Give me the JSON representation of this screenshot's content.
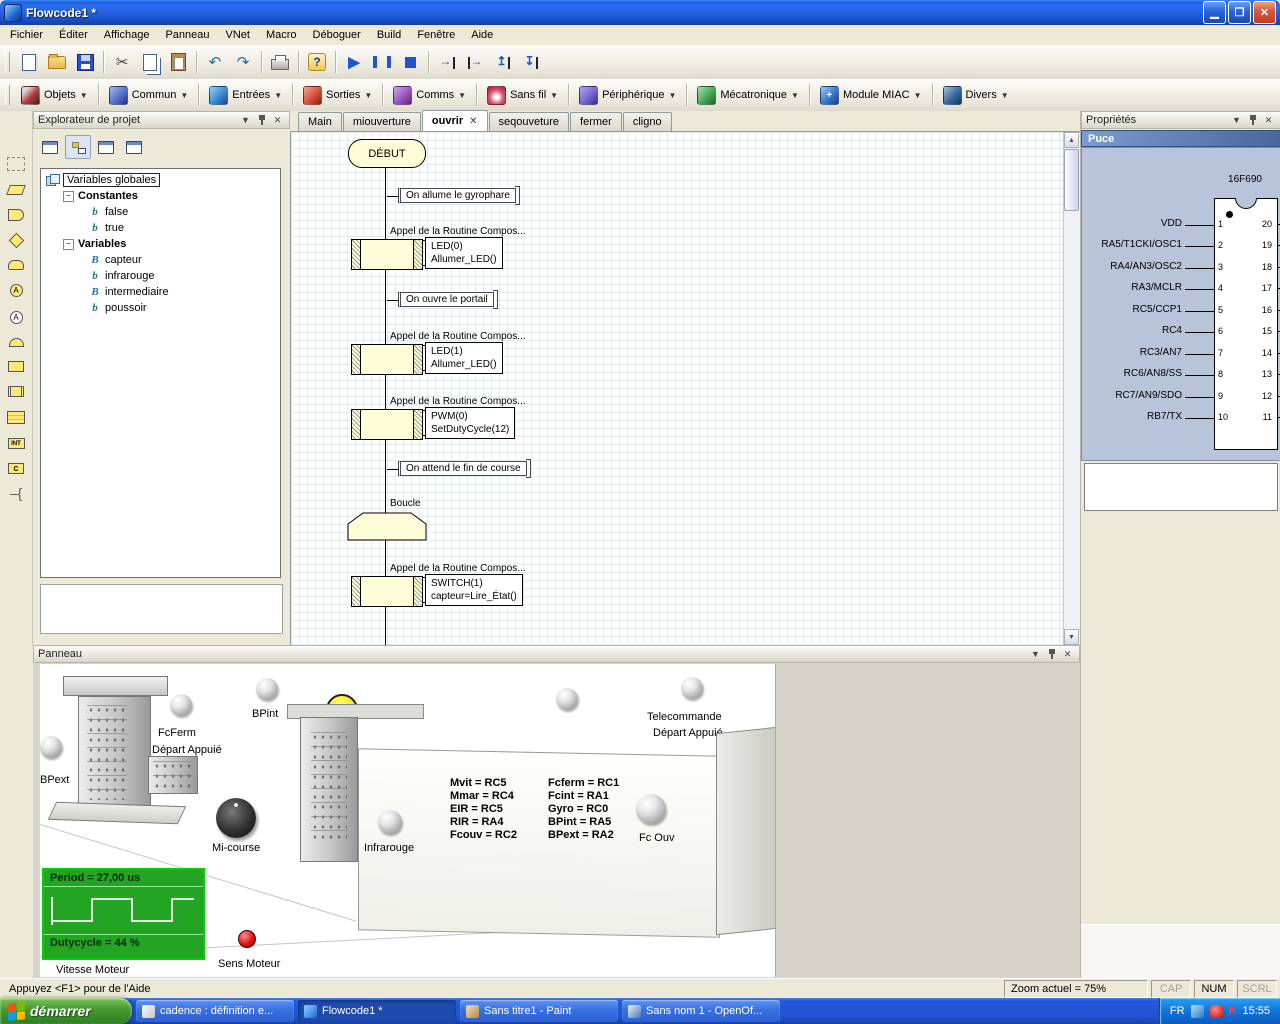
{
  "colors": {
    "titlebar_blue": "#1E5EE8",
    "taskbar_blue": "#2458DC",
    "start_green": "#469A31",
    "flow_yellow": "#FFFCD8",
    "scope_green": "#23A423",
    "puce_banner_blue": "#46689C"
  },
  "window": {
    "title": "Flowcode1 *"
  },
  "menubar": {
    "items": [
      "Fichier",
      "Éditer",
      "Affichage",
      "Panneau",
      "VNet",
      "Macro",
      "Déboguer",
      "Build",
      "Fenêtre",
      "Aide"
    ]
  },
  "toolbar": {
    "buttons": [
      "new-icon",
      "open-icon",
      "save-icon",
      "cut-icon",
      "copy-icon",
      "paste-icon",
      "undo-icon",
      "redo-icon",
      "print-icon",
      "help-icon",
      "run-icon",
      "pause-icon",
      "stop-icon",
      "step-into-icon",
      "step-over-icon",
      "step-out-icon",
      "run-to-cursor-icon"
    ]
  },
  "components": {
    "items": [
      {
        "label": "Objets",
        "icon": "objects-icon"
      },
      {
        "label": "Commun",
        "icon": "common-icon"
      },
      {
        "label": "Entrées",
        "icon": "inputs-icon"
      },
      {
        "label": "Sorties",
        "icon": "outputs-icon"
      },
      {
        "label": "Comms",
        "icon": "comms-icon"
      },
      {
        "label": "Sans fil",
        "icon": "wireless-icon"
      },
      {
        "label": "Périphérique",
        "icon": "peripheral-icon"
      },
      {
        "label": "Mécatronique",
        "icon": "mechatronics-icon"
      },
      {
        "label": "Module MIAC",
        "icon": "miac-module-icon"
      },
      {
        "label": "Divers",
        "icon": "misc-icon"
      }
    ]
  },
  "left_toolbar": {
    "icons": [
      "selection-icon",
      "io-icon",
      "delay-icon",
      "decision-icon",
      "switch-icon",
      "connection-point-icon",
      "jump-icon",
      "event-icon",
      "calculation-icon",
      "component-macro-icon",
      "macro-icon",
      "interrupt-icon",
      "c-code-icon",
      "comment-icon"
    ]
  },
  "explorer": {
    "title": "Explorateur de projet",
    "root": "Variables globales",
    "groups": [
      {
        "label": "Constantes",
        "items": [
          "false",
          "true"
        ]
      },
      {
        "label": "Variables",
        "items": [
          "capteur",
          "infrarouge",
          "intermediaire",
          "poussoir"
        ]
      }
    ]
  },
  "tabs": {
    "active": "ouvrir",
    "items": [
      {
        "label": "Main"
      },
      {
        "label": "miouverture"
      },
      {
        "label": "ouvrir"
      },
      {
        "label": "seqouveture"
      },
      {
        "label": "fermer"
      },
      {
        "label": "cligno"
      }
    ]
  },
  "flowchart": {
    "start_label": "DÉBUT",
    "routine_caption": "Appel de la Routine Compos...",
    "loop_caption": "Boucle",
    "comments": [
      "On allume le gyrophare",
      "On ouvre le portail",
      "On attend le fin de course"
    ],
    "calls": [
      {
        "line1": "LED(0)",
        "line2": "Allumer_LED()"
      },
      {
        "line1": "LED(1)",
        "line2": "Allumer_LED()"
      },
      {
        "line1": "PWM(0)",
        "line2": "SetDutyCycle(12)"
      },
      {
        "line1": "SWITCH(1)",
        "line2": "capteur=Lire_État()"
      }
    ]
  },
  "properties": {
    "title": "Propriétés",
    "section": "Puce",
    "chip_name": "16F690",
    "left_pins": [
      {
        "label": "VDD",
        "num": "1"
      },
      {
        "label": "RA5/T1CKI/OSC1",
        "num": "2"
      },
      {
        "label": "RA4/AN3/OSC2",
        "num": "3"
      },
      {
        "label": "RA3/MCLR",
        "num": "4"
      },
      {
        "label": "RC5/CCP1",
        "num": "5"
      },
      {
        "label": "RC4",
        "num": "6"
      },
      {
        "label": "RC3/AN7",
        "num": "7"
      },
      {
        "label": "RC6/AN8/SS",
        "num": "8"
      },
      {
        "label": "RC7/AN9/SDO",
        "num": "9"
      },
      {
        "label": "RB7/TX",
        "num": "10"
      }
    ],
    "right_pins": [
      "20",
      "19",
      "18",
      "17",
      "16",
      "15",
      "14",
      "13",
      "12",
      "11"
    ]
  },
  "panel": {
    "title": "Panneau",
    "labels": {
      "bpext": "BPext",
      "fcferm": "FcFerm",
      "fcferm2": "Départ Appuié",
      "bpint": "BPint",
      "telecommande": "Telecommande",
      "telecommande2": "Départ Appuié",
      "micourse": "Mi-course",
      "infrarouge": "Infrarouge",
      "fcouv": "Fc Ouv",
      "sens": "Sens Moteur",
      "vitesse": "Vitesse Moteur"
    },
    "pinmap": {
      "left": [
        "Mvit = RC5",
        "Mmar = RC4",
        "EIR = RC5",
        "RIR = RA4",
        "Fcouv = RC2"
      ],
      "right": [
        "Fcferm = RC1",
        "Fcint = RA1",
        "Gyro = RC0",
        "BPint = RA5",
        "BPext = RA2"
      ]
    },
    "scope": {
      "period": "Period =  27,00 us",
      "duty": "Dutycycle =  44 %"
    }
  },
  "statusbar": {
    "help": "Appuyez <F1> pour de l'Aide",
    "zoom": "Zoom actuel = 75%",
    "cap": "CAP",
    "num": "NUM",
    "scrl": "SCRL"
  },
  "taskbar": {
    "start": "démarrer",
    "tasks": [
      {
        "label": "cadence : définition e..."
      },
      {
        "label": "Flowcode1 *"
      },
      {
        "label": "Sans titre1 - Paint"
      },
      {
        "label": "Sans nom 1 - OpenOf..."
      }
    ],
    "tray": {
      "lang": "FR",
      "k": "K",
      "time": "15:55"
    }
  }
}
